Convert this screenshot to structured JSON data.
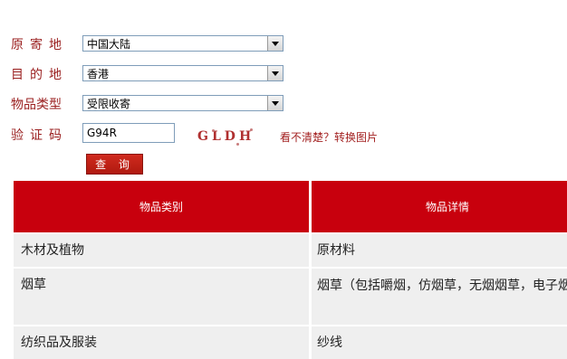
{
  "form": {
    "origin": {
      "label": "原寄地",
      "value": "中国大陆"
    },
    "destination": {
      "label": "目的地",
      "value": "香港"
    },
    "item_type": {
      "label": "物品类型",
      "value": "受限收寄"
    },
    "captcha": {
      "label": "验证码",
      "value": "G94R",
      "image_text": "GLDH",
      "refresh_text": "看不清楚？转换图片"
    },
    "query_button": "查 询"
  },
  "table": {
    "columns": [
      "物品类别",
      "物品详情"
    ],
    "rows": [
      [
        "木材及植物",
        "原材料"
      ],
      [
        "烟草",
        "烟草（包括嚼烟，仿烟草，无烟烟草，电子烟）"
      ],
      [
        "纺织品及服装",
        "纱线"
      ]
    ]
  },
  "colors": {
    "label": "#9a1f1f",
    "header_bg": "#c8000d",
    "row_bg": "#efefef",
    "button_bg": "#c0201a"
  },
  "icons": [
    "dropdown-arrow-icon"
  ]
}
